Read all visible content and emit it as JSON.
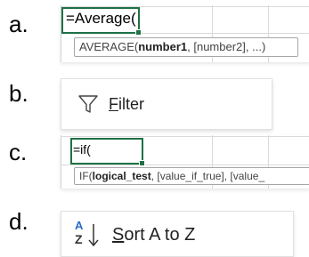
{
  "rows": [
    {
      "letter": "a.",
      "cell_text": "=Average(",
      "tooltip": {
        "fn": "AVERAGE(",
        "arg_bold": "number1",
        "rest": ", [number2], ...)"
      }
    },
    {
      "letter": "b.",
      "button": {
        "icon": "filter-icon",
        "accel": "F",
        "label_rest": "ilter"
      }
    },
    {
      "letter": "c.",
      "cell_text": "=if(",
      "tooltip": {
        "fn": "IF(",
        "arg_bold": "logical_test",
        "rest": ", [value_if_true], [value_"
      }
    },
    {
      "letter": "d.",
      "button": {
        "icon": "sort-a-to-z-icon",
        "icon_top": "A",
        "icon_bottom": "Z",
        "accel": "S",
        "label_rest": "ort A to Z"
      }
    }
  ],
  "colors": {
    "active_cell_border": "#1e7145",
    "sort_icon_blue": "#2b6cc4",
    "gridline": "#dadada"
  }
}
